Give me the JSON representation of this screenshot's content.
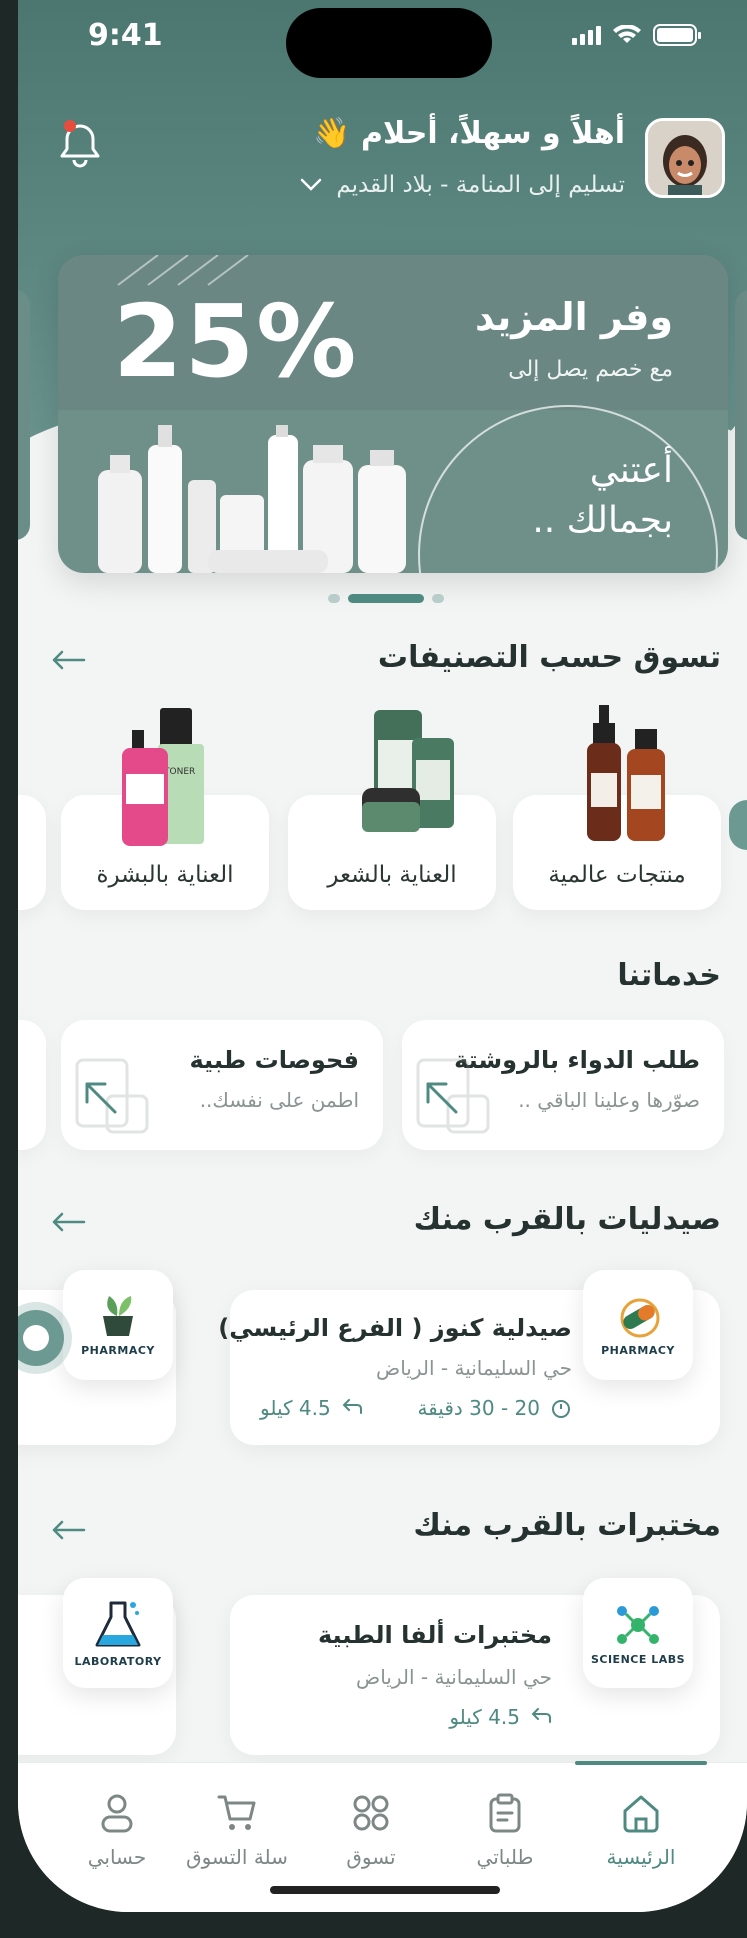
{
  "status": {
    "time": "9:41"
  },
  "header": {
    "greeting": "أهلاً و سهلاً، أحلام 👋",
    "delivery": "تسليم إلى المنامة - بلاد القديم"
  },
  "banner": {
    "title": "وفر المزيد",
    "subtitle": "مع خصم يصل إلى",
    "percent": "25%",
    "tagline_1": "أعتني",
    "tagline_2": "بجمالك .."
  },
  "categories": {
    "title": "تسوق حسب التصنيفات",
    "items": [
      {
        "label": "منتجات عالمية"
      },
      {
        "label": "العناية بالشعر"
      },
      {
        "label": "العناية بالبشرة"
      }
    ]
  },
  "services": {
    "title": "خدماتنا",
    "items": [
      {
        "title": "طلب الدواء بالروشتة",
        "subtitle": "صوّرها وعلينا الباقي .."
      },
      {
        "title": "فحوصات طبية",
        "subtitle": "اطمن على نفسك.."
      }
    ]
  },
  "pharmacies": {
    "title": "صيدليات بالقرب منك",
    "items": [
      {
        "name": "صيدلية كنوز ( الفرع الرئيسي)",
        "address": "حي السليمانية - الرياض",
        "time": "20 - 30 دقيقة",
        "distance": "4.5 كيلو",
        "logo_text": "PHARMACY"
      },
      {
        "logo_text": "PHARMACY"
      }
    ]
  },
  "labs": {
    "title": "مختبرات بالقرب منك",
    "items": [
      {
        "name": "مختبرات ألفا الطبية",
        "address": "حي السليمانية - الرياض",
        "distance": "4.5 كيلو",
        "logo_text": "SCIENCE LABS"
      },
      {
        "logo_text": "LABORATORY"
      }
    ]
  },
  "nav": {
    "items": [
      {
        "label": "الرئيسية",
        "icon": "home-icon",
        "active": true
      },
      {
        "label": "طلباتي",
        "icon": "clipboard-icon"
      },
      {
        "label": "تسوق",
        "icon": "grid-icon"
      },
      {
        "label": "سلة التسوق",
        "icon": "cart-icon"
      },
      {
        "label": "حسابي",
        "icon": "user-icon"
      }
    ]
  },
  "colors": {
    "primary": "#4e8a82",
    "header": "#5c8680",
    "background": "#f3f5f5"
  }
}
